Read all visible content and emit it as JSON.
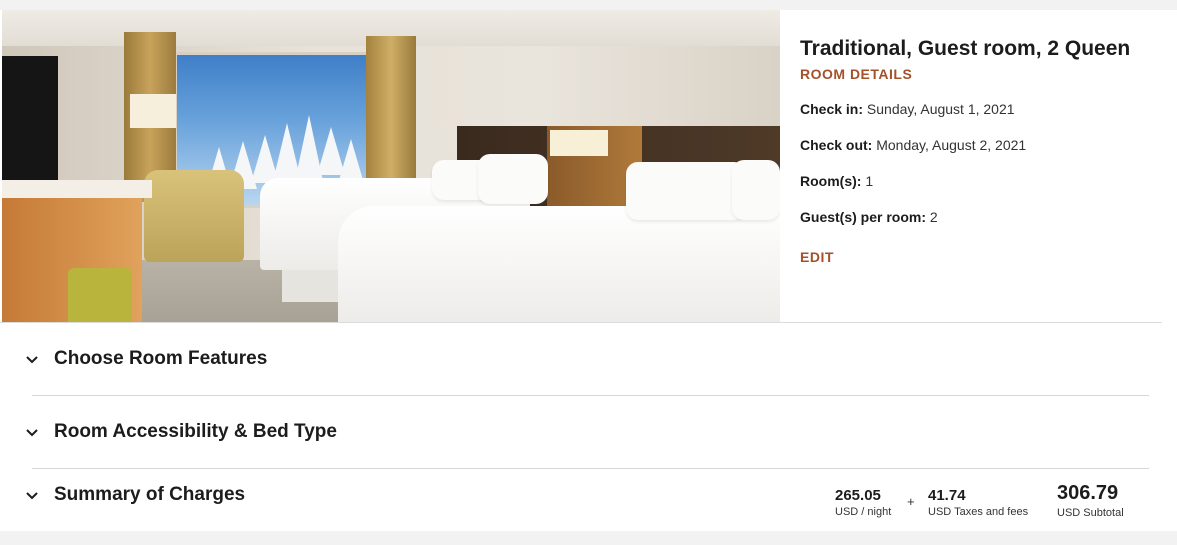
{
  "room": {
    "title": "Traditional, Guest room, 2 Queen",
    "details_link": "ROOM DETAILS",
    "check_in": {
      "label": "Check in:",
      "value": "Sunday, August 1, 2021"
    },
    "check_out": {
      "label": "Check out:",
      "value": "Monday, August 2, 2021"
    },
    "rooms": {
      "label": "Room(s):",
      "value": "1"
    },
    "guests": {
      "label": "Guest(s) per room:",
      "value": "2"
    },
    "edit_link": "EDIT"
  },
  "sections": {
    "features": "Choose Room Features",
    "accessibility": "Room Accessibility & Bed Type",
    "summary": "Summary of Charges"
  },
  "charges": {
    "rate": {
      "amount": "265.05",
      "label": "USD / night"
    },
    "plus": "+",
    "taxes": {
      "amount": "41.74",
      "label": "USD Taxes and fees"
    },
    "subtotal": {
      "amount": "306.79",
      "label": "USD Subtotal"
    }
  },
  "colors": {
    "accent": "#a4512a",
    "text": "#1c1c1c",
    "background": "#f2f2f2",
    "card": "#ffffff"
  },
  "icons": {
    "chevron": "chevron-down-icon"
  }
}
